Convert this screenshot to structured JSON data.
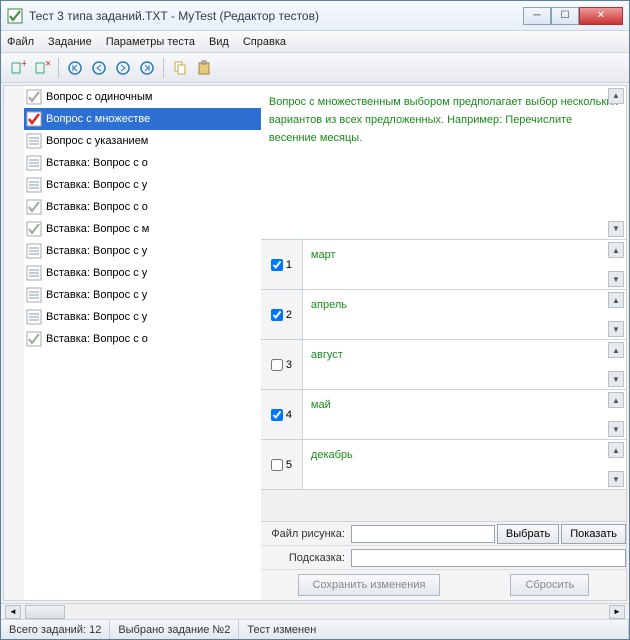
{
  "title": "Тест 3 типа заданий.TXT - MyTest (Редактор тестов)",
  "menu": [
    "Файл",
    "Задание",
    "Параметры теста",
    "Вид",
    "Справка"
  ],
  "toolbar_icons": [
    "tree-add",
    "tree-del",
    "nav-first",
    "nav-prev",
    "nav-next",
    "nav-last",
    "copy",
    "paste"
  ],
  "tree": {
    "items": [
      {
        "label": "Вопрос с одиночным",
        "icon": "check-grey",
        "selected": false
      },
      {
        "label": "Вопрос с множестве",
        "icon": "check-red",
        "selected": true
      },
      {
        "label": "Вопрос с указанием",
        "icon": "lines",
        "selected": false
      },
      {
        "label": "Вставка: Вопрос с о",
        "icon": "lines",
        "selected": false
      },
      {
        "label": "Вставка: Вопрос с у",
        "icon": "lines",
        "selected": false
      },
      {
        "label": "Вставка: Вопрос с о",
        "icon": "check-grey",
        "selected": false
      },
      {
        "label": "Вставка: Вопрос с м",
        "icon": "check-grey",
        "selected": false
      },
      {
        "label": "Вставка: Вопрос с у",
        "icon": "lines",
        "selected": false
      },
      {
        "label": "Вставка: Вопрос с у",
        "icon": "lines",
        "selected": false
      },
      {
        "label": "Вставка: Вопрос с у",
        "icon": "lines",
        "selected": false
      },
      {
        "label": "Вставка: Вопрос с у",
        "icon": "lines",
        "selected": false
      },
      {
        "label": "Вставка: Вопрос с о",
        "icon": "check-grey",
        "selected": false
      }
    ]
  },
  "question_text": "Вопрос с множественным выбором предполагает выбор нескольких вариантов из всех предложенных. Например: Перечислите весенние месяцы.",
  "answers": [
    {
      "num": "1",
      "checked": true,
      "text": "март"
    },
    {
      "num": "2",
      "checked": true,
      "text": "апрель"
    },
    {
      "num": "3",
      "checked": false,
      "text": "август"
    },
    {
      "num": "4",
      "checked": true,
      "text": "май"
    },
    {
      "num": "5",
      "checked": false,
      "text": "декабрь"
    }
  ],
  "file_row": {
    "label": "Файл рисунка:",
    "choose": "Выбрать",
    "show": "Показать"
  },
  "hint_row": {
    "label": "Подсказка:"
  },
  "actions": {
    "save": "Сохранить изменения",
    "reset": "Сбросить"
  },
  "status": {
    "total": "Всего заданий: 12",
    "selected": "Выбрано задание №2",
    "changed": "Тест изменен"
  }
}
